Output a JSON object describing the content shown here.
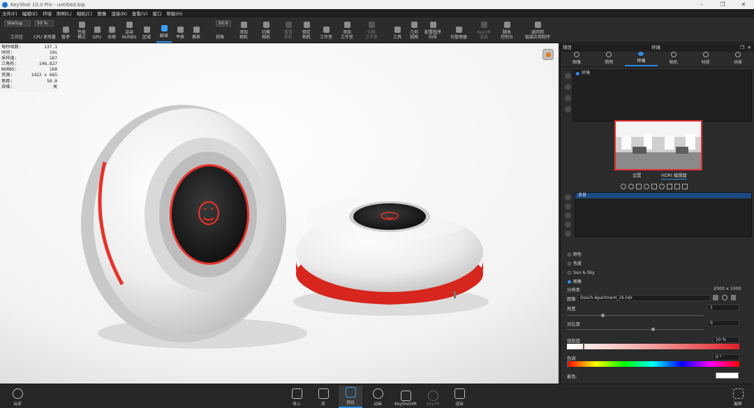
{
  "window": {
    "title": "KeyShot 10.0 Pro  -  untitled.bip"
  },
  "menu": [
    "文件(F)",
    "编辑(E)",
    "环境",
    "照明(L)",
    "相机(C)",
    "图像",
    "渲染(R)",
    "查看(V)",
    "窗口",
    "帮助(H)"
  ],
  "toolbar": {
    "workspace_combo": "Startup",
    "zoom_combo": "50 %",
    "fov_value": "50.0",
    "items": [
      {
        "label": "工作区"
      },
      {
        "label": "CPU 使用量"
      },
      {
        "label": "暂停"
      },
      {
        "label": "性能\n模式"
      },
      {
        "label": "GPU"
      },
      {
        "label": "去噪"
      },
      {
        "label": "渲染\nNURBS"
      },
      {
        "label": "区域"
      },
      {
        "label": "翻滚"
      },
      {
        "label": "平移"
      },
      {
        "label": "推移"
      },
      {
        "label": "视角"
      },
      {
        "label": "添加\n相机"
      },
      {
        "label": "切换\n相机"
      },
      {
        "label": "重置\n相机"
      },
      {
        "label": "锁定\n相机"
      },
      {
        "label": "工作室"
      },
      {
        "label": "添加\n工作室"
      },
      {
        "label": "切换\n工作室"
      },
      {
        "label": "工具"
      },
      {
        "label": "几何\n视图"
      },
      {
        "label": "配置程序\n向导"
      },
      {
        "label": "光管理器"
      },
      {
        "label": "KeyVR\n渲染"
      },
      {
        "label": "脚本\n控制台"
      },
      {
        "label": "返回到\n链接应用程序"
      }
    ]
  },
  "stats": [
    {
      "k": "每秒帧数:",
      "v": "137.1"
    },
    {
      "k": "时间:",
      "v": "19s"
    },
    {
      "k": "采样值:",
      "v": "167"
    },
    {
      "k": "三角形:",
      "v": "146,827"
    },
    {
      "k": "NURBS:",
      "v": "168"
    },
    {
      "k": "资源:",
      "v": "1422 x 665"
    },
    {
      "k": "焦距:",
      "v": "50.0"
    },
    {
      "k": "去噪:",
      "v": "关"
    }
  ],
  "panel": {
    "header_left": "项目",
    "header_center": "环境",
    "tabs": [
      "图像",
      "照明",
      "环境",
      "相机",
      "材质",
      "场景"
    ],
    "env_list": [
      "环境"
    ],
    "subtabs": [
      "设置",
      "HDRI 编辑器"
    ],
    "layer_list": [
      "背景"
    ],
    "bg_options": [
      "颜色",
      "色度",
      "Sun & Sky",
      "图像"
    ],
    "resolution_label": "分辨率",
    "resolution_value": "2000 x 1000",
    "image_label": "图像",
    "image_value": "Dosch-Apartment_2k.hdr",
    "brightness_label": "亮度",
    "brightness_value": "1",
    "contrast_label": "对比度",
    "contrast_value": "0",
    "saturation_label": "饱和度",
    "saturation_value": "10 %",
    "hue_label": "色调",
    "hue_value": "0 °",
    "tint_label": "着色:"
  },
  "bottom": {
    "cloud": "云库",
    "items": [
      "导入",
      "库",
      "项目",
      "动画",
      "KeyShotXR",
      "KeyVR",
      "渲染"
    ],
    "fullscreen": "截屏"
  }
}
